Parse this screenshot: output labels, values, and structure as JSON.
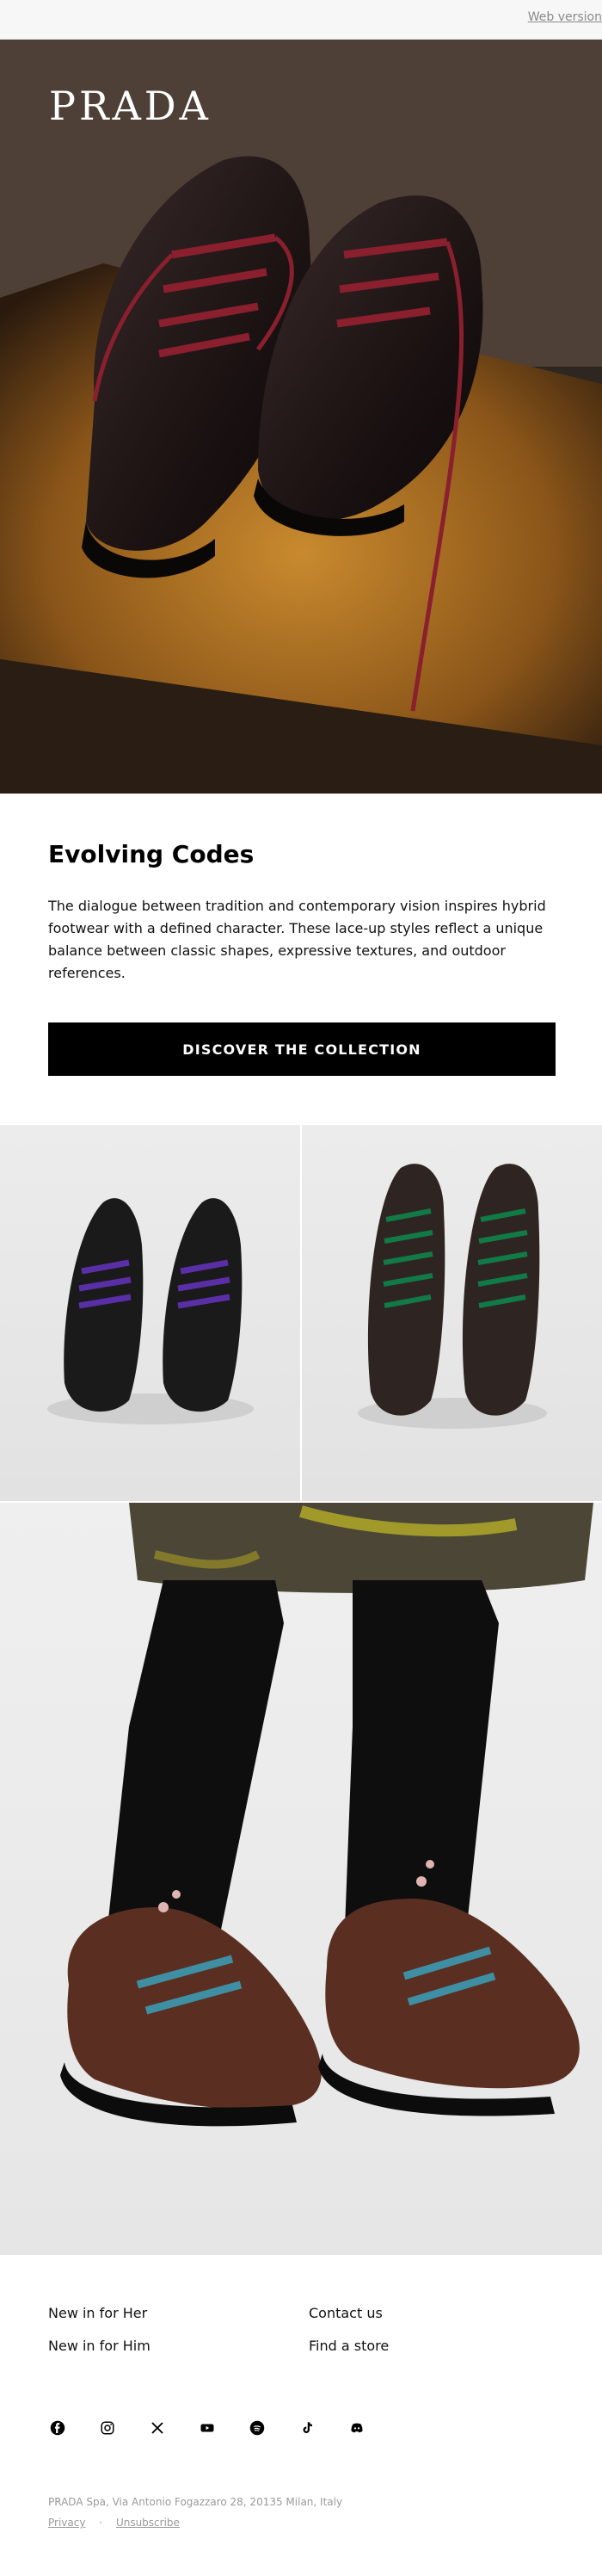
{
  "topbar": {
    "web_version": "Web version"
  },
  "hero": {
    "logo": "PRADA"
  },
  "intro": {
    "title": "Evolving Codes",
    "body": "The dialogue between tradition and contemporary vision inspires hybrid footwear with a defined character. These lace-up styles reflect a unique balance between classic shapes, expressive textures, and outdoor references.",
    "cta": "DISCOVER THE COLLECTION"
  },
  "footer": {
    "links": [
      "New in for Her",
      "New in for Him",
      "Contact us",
      "Find a store"
    ],
    "social": [
      "facebook-icon",
      "instagram-icon",
      "x-icon",
      "youtube-icon",
      "spotify-icon",
      "tiktok-icon",
      "discord-icon"
    ],
    "address": "PRADA Spa, Via Antonio Fogazzaro 28, 20135 Milan, Italy",
    "privacy": "Privacy",
    "separator": "·",
    "unsubscribe": "Unsubscribe"
  }
}
